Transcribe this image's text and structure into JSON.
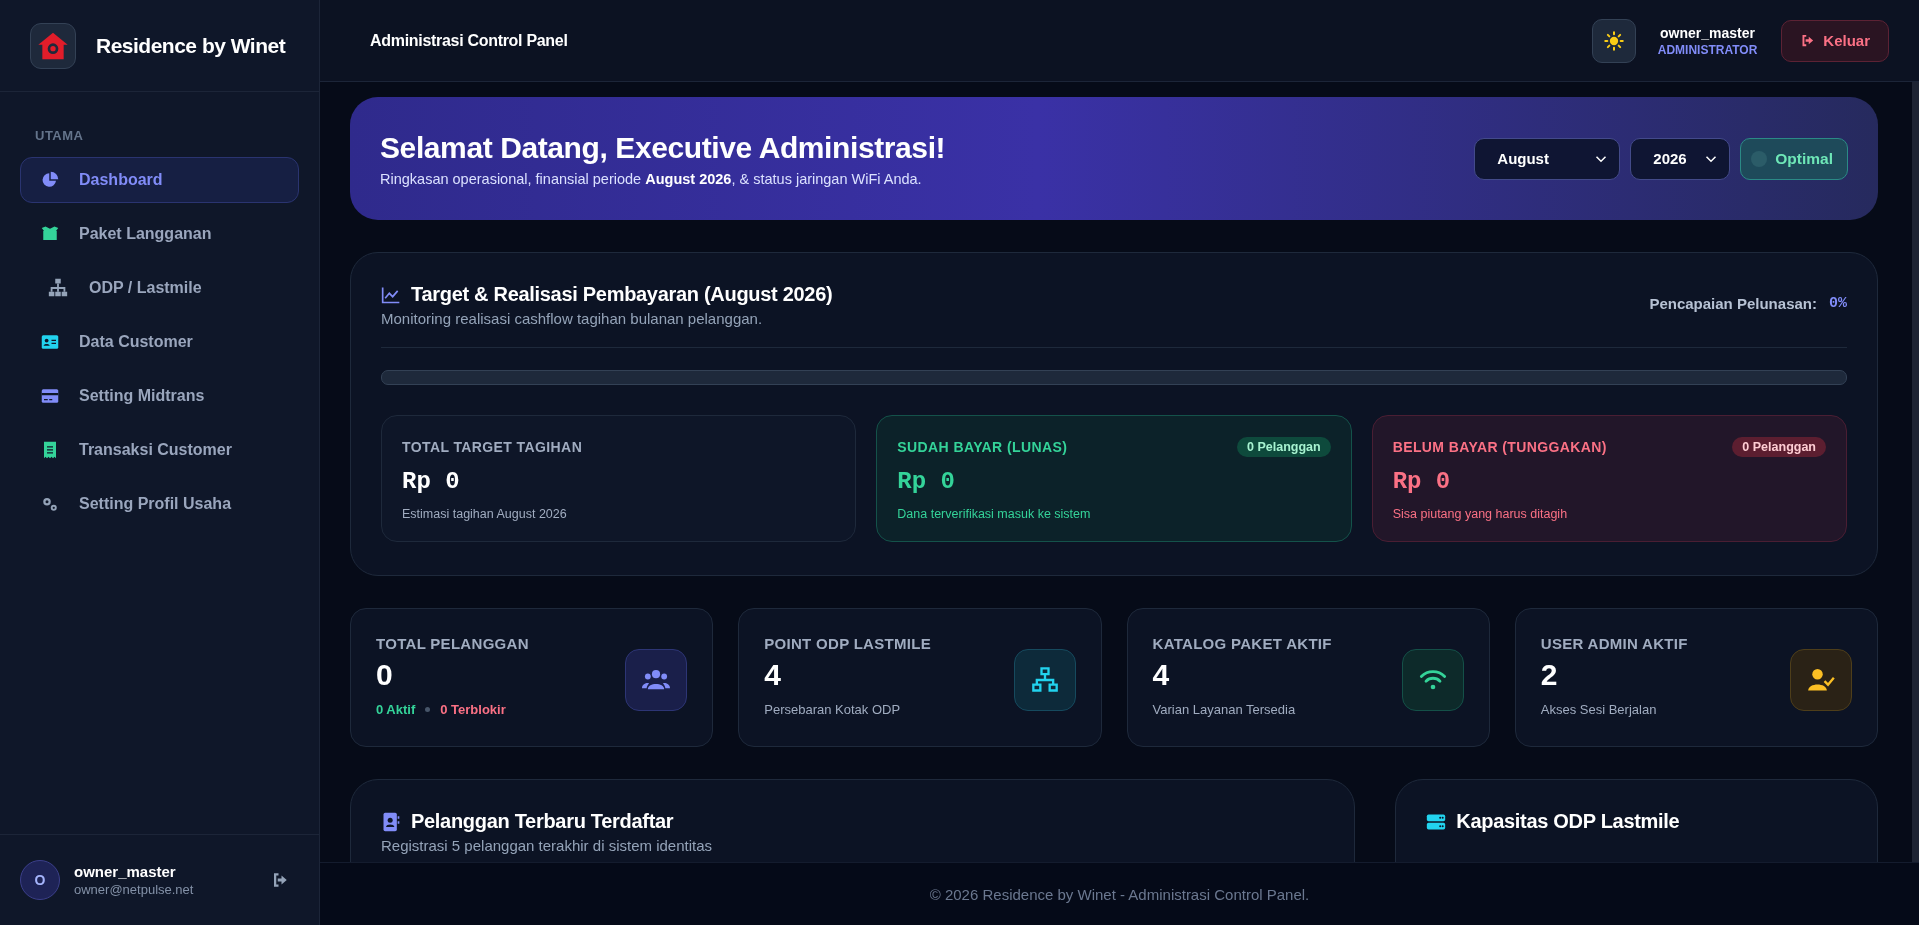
{
  "brand": {
    "name": "Residence by Winet"
  },
  "sidebar": {
    "section": "UTAMA",
    "items": [
      {
        "label": "Dashboard",
        "selected": true
      },
      {
        "label": "Paket Langganan",
        "selected": false
      },
      {
        "label": "ODP / Lastmile",
        "selected": false
      },
      {
        "label": "Data Customer",
        "selected": false
      },
      {
        "label": "Setting Midtrans",
        "selected": false
      },
      {
        "label": "Transaksi Customer",
        "selected": false
      },
      {
        "label": "Setting Profil Usaha",
        "selected": false
      }
    ],
    "user": {
      "initial": "O",
      "name": "owner_master",
      "email": "owner@netpulse.net"
    }
  },
  "header": {
    "title": "Administrasi Control Panel",
    "user": {
      "name": "owner_master",
      "role": "ADMINISTRATOR"
    },
    "logout": "Keluar"
  },
  "banner": {
    "title": "Selamat Datang, Executive Administrasi!",
    "subtitle": "Ringkasan operasional, finansial periode **August 2026**, & status jaringan WiFi Anda.",
    "month": "August",
    "year": "2026",
    "status": "Optimal"
  },
  "payment": {
    "title": "Target & Realisasi Pembayaran (August 2026)",
    "subtitle": "Monitoring realisasi cashflow tagihan bulanan pelanggan.",
    "achievement_label": "Pencapaian Pelunasan:",
    "achievement": "0%",
    "level": 0,
    "cards": [
      {
        "kind": "target",
        "title": "TOTAL TARGET TAGIHAN",
        "amount": "Rp 0",
        "note": "Estimasi tagihan August 2026"
      },
      {
        "kind": "paid",
        "title": "SUDAH BAYAR (LUNAS)",
        "badge": "0 Pelanggan",
        "amount": "Rp 0",
        "note": "Dana terverifikasi masuk ke sistem"
      },
      {
        "kind": "unpaid",
        "title": "BELUM BAYAR (TUNGGAKAN)",
        "badge": "0 Pelanggan",
        "amount": "Rp 0",
        "note": "Sisa piutang yang harus ditagih"
      }
    ]
  },
  "stats": [
    {
      "kind": "customers",
      "title": "TOTAL PELANGGAN",
      "value": "0",
      "active": "0 Aktif",
      "blocked": "0 Terblokir"
    },
    {
      "kind": "odp",
      "title": "POINT ODP LASTMILE",
      "value": "4",
      "note": "Persebaran Kotak ODP"
    },
    {
      "kind": "package",
      "title": "KATALOG PAKET AKTIF",
      "value": "4",
      "note": "Varian Layanan Tersedia"
    },
    {
      "kind": "admin",
      "title": "USER ADMIN AKTIF",
      "value": "2",
      "note": "Akses Sesi Berjalan"
    }
  ],
  "panels": [
    {
      "kind": "customers",
      "title": "Pelanggan Terbaru Terdaftar",
      "subtitle": "Registrasi 5 pelanggan terakhir di sistem identitas"
    },
    {
      "kind": "capacity",
      "title": "Kapasitas ODP Lastmile"
    }
  ],
  "footer": "© 2026 Residence by Winet - Administrasi Control Panel."
}
